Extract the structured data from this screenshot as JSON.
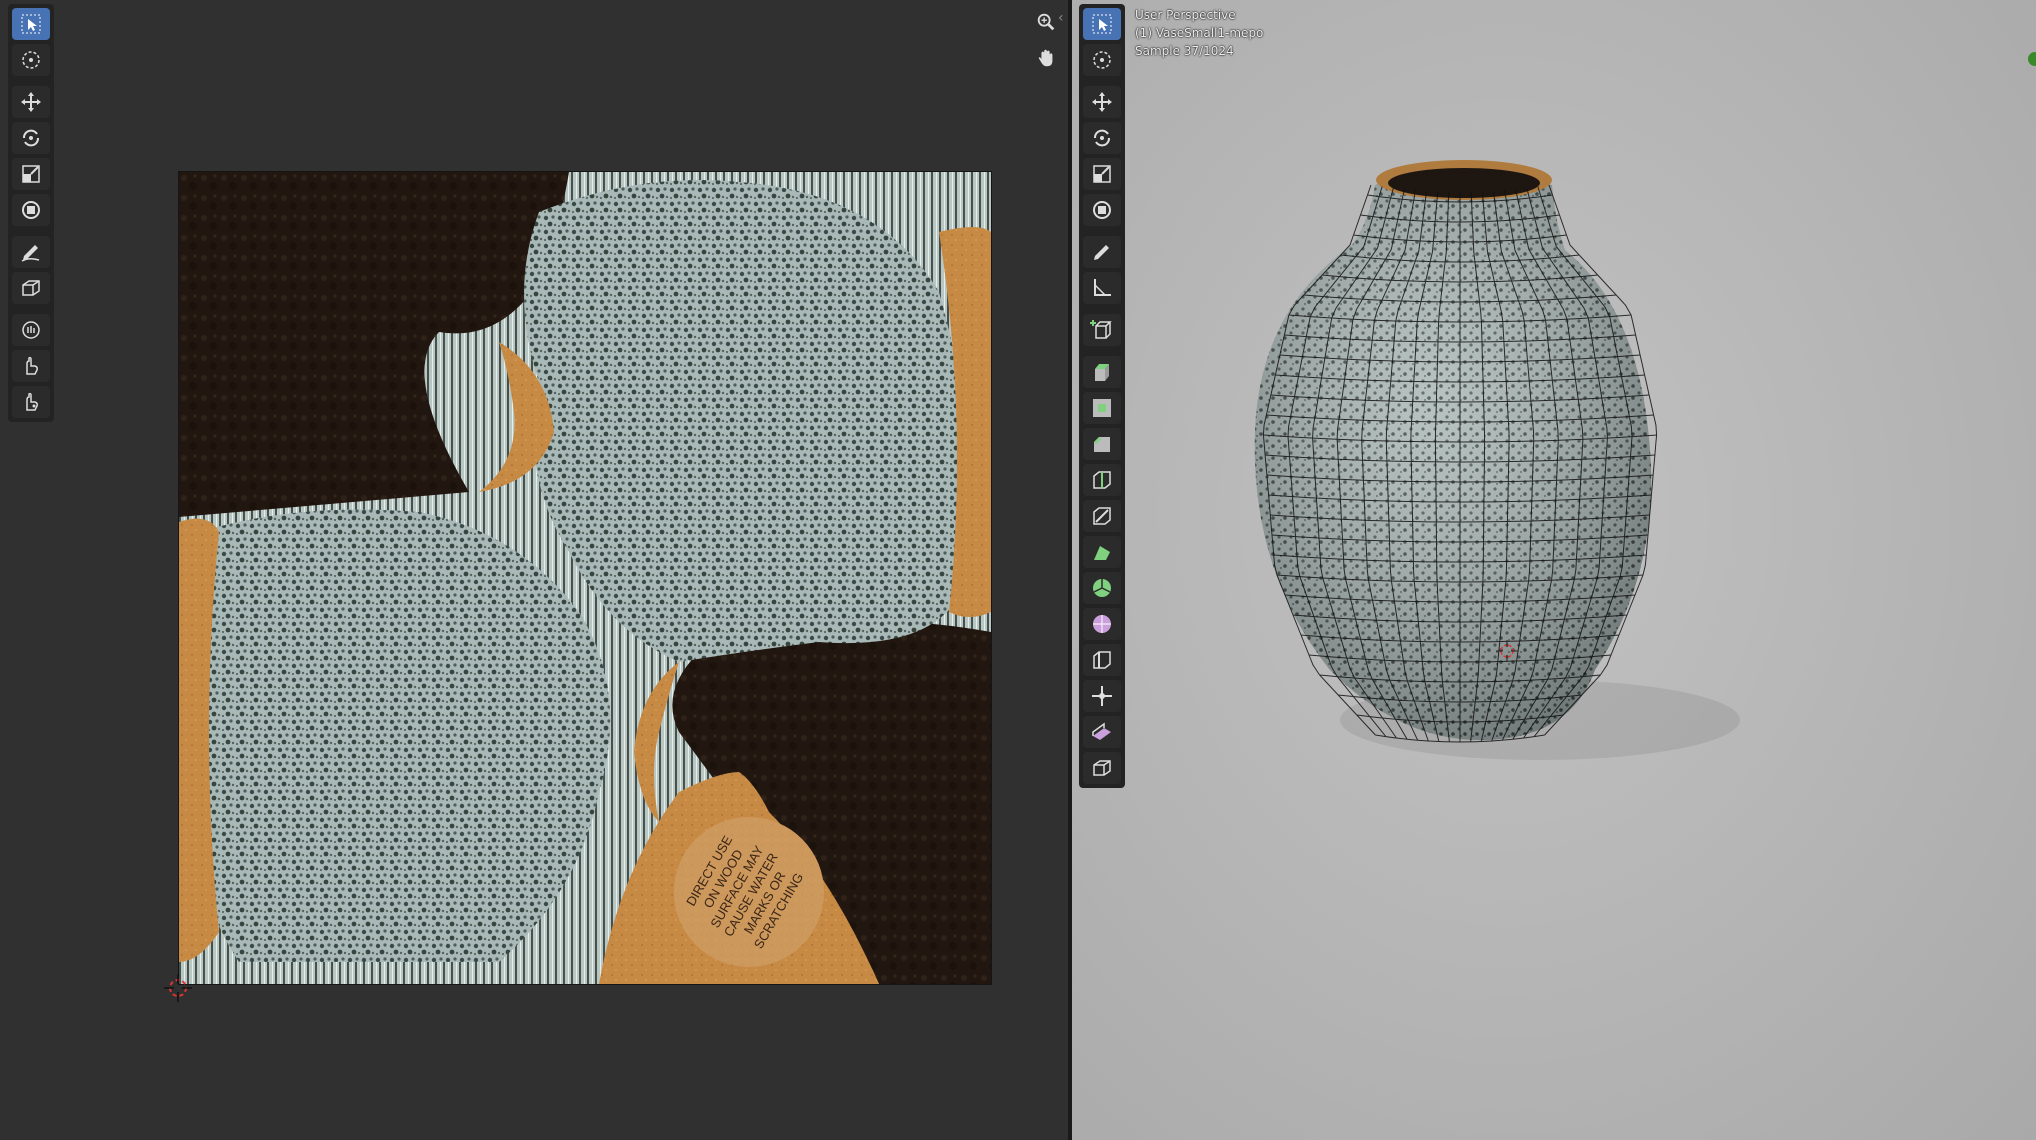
{
  "uv_editor": {
    "image_label_text": "DIRECT USE ON WOOD SURFACE MAY CAUSE WATER MARKS OR SCRATCHING",
    "image_label_lines": [
      "DIRECT USE",
      "ON WOOD",
      "SURFACE MAY",
      "CAUSE WATER",
      "MARKS OR",
      "SCRATCHING"
    ],
    "toolbar_tools": [
      "select-box",
      "cursor",
      "move",
      "rotate",
      "scale",
      "transform",
      "annotate",
      "rip-region",
      "grab",
      "relax",
      "pinch"
    ],
    "navigation": [
      "zoom-icon",
      "pan-hand-icon"
    ]
  },
  "viewport": {
    "view_name": "User Perspective",
    "object_name": "(1) VaseSmall1-mepo",
    "render_samples": "Sample 37/1024",
    "toolbar_tools": [
      "select-box",
      "cursor",
      "move",
      "rotate",
      "scale",
      "transform",
      "annotate",
      "measure",
      "add-cube",
      "extrude-region",
      "inset-faces",
      "bevel",
      "loop-cut",
      "knife",
      "poly-build",
      "spin",
      "smooth",
      "edge-slide",
      "shrink-fatten",
      "shear",
      "rip-region"
    ]
  },
  "colors": {
    "editor_bg": "#303030",
    "toolbar_bg": "#232323",
    "active_tool": "#4772b3",
    "viewport_bg": "#b9b9b9",
    "texture_dark": "#231812",
    "texture_speckle": "#a9b9b7",
    "texture_wood": "#c78a44"
  }
}
